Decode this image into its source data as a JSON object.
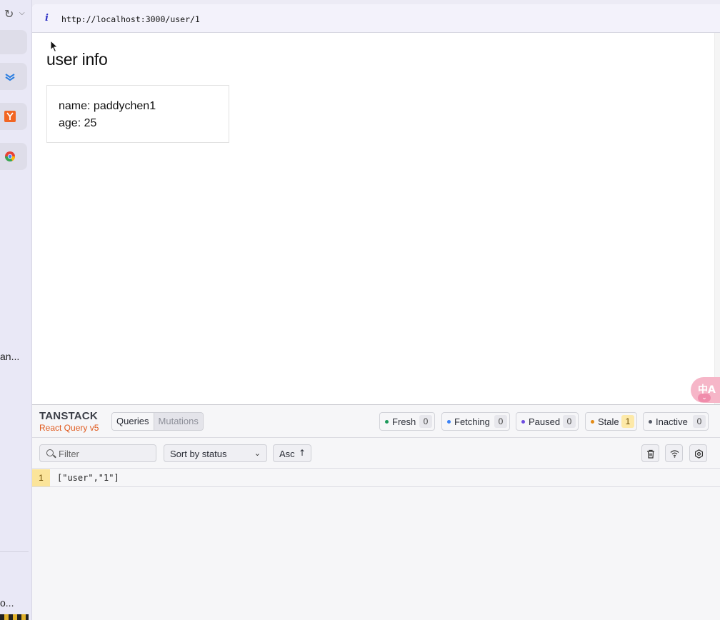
{
  "sidebar": {
    "reload_glyph": "↻",
    "chevron_glyph": "⌵",
    "truncated_text_1": "an...",
    "truncated_text_2": "o...",
    "tab_icons": [
      "layers-icon",
      "y-badge-icon",
      "chrome-like-icon"
    ]
  },
  "urlbar": {
    "info_glyph": "i",
    "url": "http://localhost:3000/user/1"
  },
  "page": {
    "title": "user info",
    "name_line": "name: paddychen1",
    "age_line": "age: 25"
  },
  "ime": {
    "label": "中A",
    "chevron": "⌄"
  },
  "devtools": {
    "logo_main": "TANSTACK",
    "logo_sub": "React Query v5",
    "tabs": [
      {
        "label": "Queries",
        "active": true
      },
      {
        "label": "Mutations",
        "active": false
      }
    ],
    "statuses": [
      {
        "label": "Fresh",
        "count": "0",
        "color": "#1e9a5b"
      },
      {
        "label": "Fetching",
        "count": "0",
        "color": "#3b82f6"
      },
      {
        "label": "Paused",
        "count": "0",
        "color": "#6d4ce0"
      },
      {
        "label": "Stale",
        "count": "1",
        "color": "#e38b16"
      },
      {
        "label": "Inactive",
        "count": "0",
        "color": "#555a66"
      }
    ],
    "filter_placeholder": "Filter",
    "sort_value": "Sort by status",
    "sort_order": "Asc",
    "sort_arrow": "↑",
    "actions": [
      "trash-icon",
      "wifi-icon",
      "settings-icon"
    ],
    "queries": [
      {
        "observers": "1",
        "key": "[\"user\",\"1\"]"
      }
    ]
  },
  "colors": {
    "accent_logo": "#e05a1e",
    "stale_highlight": "#fbe49a",
    "ime_pink": "#f6b6c8"
  }
}
